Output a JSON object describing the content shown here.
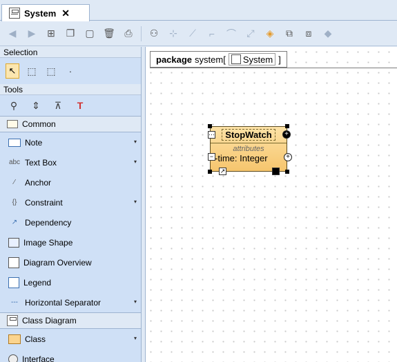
{
  "tab": {
    "label": "System",
    "close": "✕"
  },
  "toolbar": {
    "buttons": [
      "back",
      "forward",
      "diagram-props",
      "copy",
      "paste-shape",
      "delete",
      "print",
      "layout",
      "line-style",
      "path",
      "rectilinear",
      "oblique",
      "bezier",
      "fill",
      "align",
      "export",
      "attach"
    ]
  },
  "palette": {
    "selection_label": "Selection",
    "tools_label": "Tools",
    "common_label": "Common",
    "items_common": [
      {
        "label": "Note",
        "icon": "note-icon",
        "arrow": "▾"
      },
      {
        "label": "Text Box",
        "icon": "textbox-icon",
        "prefix": "abc",
        "arrow": "▾"
      },
      {
        "label": "Anchor",
        "icon": "anchor-icon"
      },
      {
        "label": "Constraint",
        "icon": "constraint-icon",
        "prefix": "{}",
        "arrow": "▾"
      },
      {
        "label": "Dependency",
        "icon": "dependency-icon"
      },
      {
        "label": "Image Shape",
        "icon": "image-icon"
      },
      {
        "label": "Diagram Overview",
        "icon": "overview-icon"
      },
      {
        "label": "Legend",
        "icon": "legend-icon"
      },
      {
        "label": "Horizontal Separator",
        "icon": "separator-icon",
        "prefix": "---",
        "arrow": "▾"
      }
    ],
    "class_diagram_label": "Class Diagram",
    "items_class": [
      {
        "label": "Class",
        "icon": "class-icon",
        "arrow": "▾"
      },
      {
        "label": "Interface",
        "icon": "interface-icon"
      }
    ]
  },
  "diagram": {
    "package_keyword": "package",
    "package_name": "system[",
    "package_link": "System",
    "package_close": "]",
    "class": {
      "name": "StopWatch",
      "compartment": "attributes",
      "attribute": "-time: Integer"
    }
  }
}
